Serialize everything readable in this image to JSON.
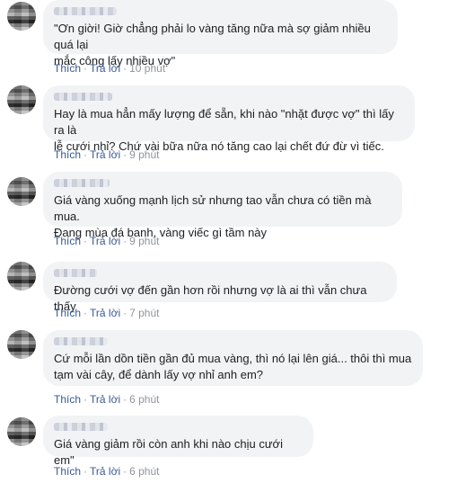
{
  "comments": [
    {
      "text": "\"Ơn giời! Giờ chẳng phải lo vàng tăng nữa mà sợ giảm nhiều quá lại\nmắc công lấy nhiều vợ\"",
      "like": "Thích",
      "reply": "Trả lời",
      "time": "10 phút"
    },
    {
      "text": "Hay là mua hẳn mấy lượng để sẵn, khi nào \"nhặt được vợ\" thì lấy ra là\nlễ cưới nhỉ? Chứ vài bữa nữa nó tăng cao lại chết đứ đừ vì tiếc.",
      "like": "Thích",
      "reply": "Trả lời",
      "time": "9 phút"
    },
    {
      "text": "Giá vàng xuống mạnh lịch sử nhưng tao vẫn chưa có tiền mà mua.\nĐang mùa đá banh, vàng viếc gì tầm này",
      "like": "Thích",
      "reply": "Trả lời",
      "time": "9 phút"
    },
    {
      "text": "Đường cưới vợ đến gần hơn rồi nhưng vợ là ai thì vẫn chưa thấy",
      "like": "Thích",
      "reply": "Trả lời",
      "time": "7 phút"
    },
    {
      "text": "Cứ mỗi lần dồn tiền gần đủ mua vàng, thì nó lại lên giá... thôi thì mua\ntạm vài cây, để dành lấy vợ nhỉ anh em?",
      "like": "Thích",
      "reply": "Trả lời",
      "time": "6 phút"
    },
    {
      "text": "Giá vàng giảm rồi còn anh khi nào chịu cưới em\"",
      "like": "Thích",
      "reply": "Trả lời",
      "time": "6 phút"
    }
  ],
  "separator": "·",
  "colors": {
    "bubble": "#f2f3f5",
    "link": "#385898",
    "meta": "#90949c",
    "text": "#1c1e21"
  }
}
